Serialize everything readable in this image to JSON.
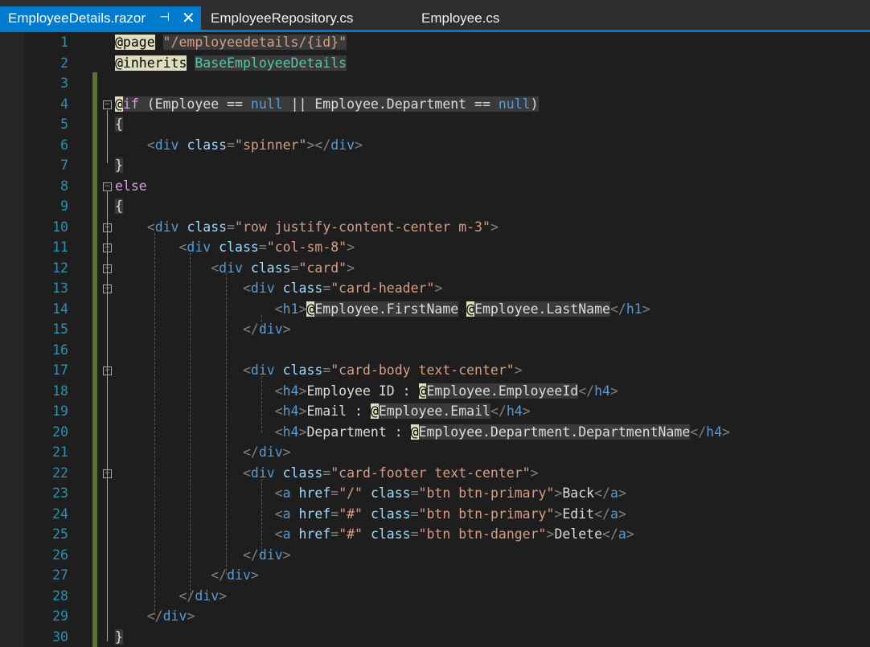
{
  "tabs": [
    {
      "label": "EmployeeDetails.razor",
      "active": true
    },
    {
      "label": "EmployeeRepository.cs",
      "active": false
    },
    {
      "label": "Employee.cs",
      "active": false
    }
  ],
  "icons": {
    "pin": "pin-icon",
    "close": "close-icon",
    "fold": "collapse-toggle-icon"
  },
  "colors": {
    "active_tab": "#007acc",
    "editor_bg": "#1e1e1e",
    "line_number": "#2b91af",
    "change_bar": "#577430"
  },
  "code_lines": [
    "@page \"/employeedetails/{id}\"",
    "@inherits BaseEmployeeDetails",
    "",
    "@if (Employee == null || Employee.Department == null)",
    "{",
    "    <div class=\"spinner\"></div>",
    "}",
    "else",
    "{",
    "    <div class=\"row justify-content-center m-3\">",
    "        <div class=\"col-sm-8\">",
    "            <div class=\"card\">",
    "                <div class=\"card-header\">",
    "                    <h1>@Employee.FirstName @Employee.LastName</h1>",
    "                </div>",
    "",
    "                <div class=\"card-body text-center\">",
    "                    <h4>Employee ID : @Employee.EmployeeId</h4>",
    "                    <h4>Email : @Employee.Email</h4>",
    "                    <h4>Department : @Employee.Department.DepartmentName</h4>",
    "                </div>",
    "                <div class=\"card-footer text-center\">",
    "                    <a href=\"/\" class=\"btn btn-primary\">Back</a>",
    "                    <a href=\"#\" class=\"btn btn-primary\">Edit</a>",
    "                    <a href=\"#\" class=\"btn btn-danger\">Delete</a>",
    "                </div>",
    "            </div>",
    "        </div>",
    "    </div>",
    "}"
  ]
}
